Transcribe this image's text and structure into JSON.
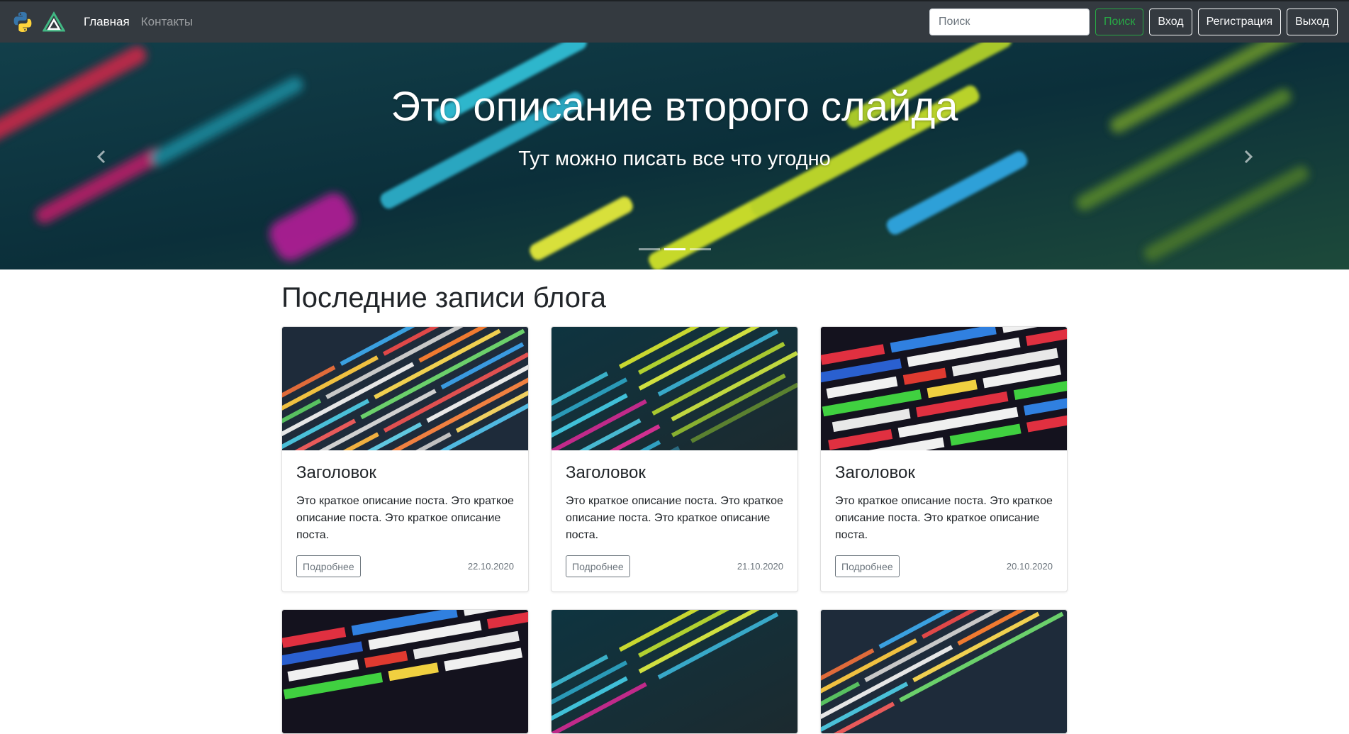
{
  "navbar": {
    "logos": [
      "python-logo",
      "vue-logo"
    ],
    "links": [
      {
        "label": "Главная",
        "active": true
      },
      {
        "label": "Контакты",
        "active": false
      }
    ],
    "search": {
      "placeholder": "Поиск",
      "value": ""
    },
    "buttons": {
      "search": "Поиск",
      "login": "Вход",
      "register": "Регистрация",
      "logout": "Выход"
    }
  },
  "carousel": {
    "title": "Это описание второго слайда",
    "subtitle": "Тут можно писать все что угодно",
    "prev_icon": "chevron-left-icon",
    "next_icon": "chevron-right-icon",
    "slide_count": 3,
    "active_slide": 2
  },
  "blog": {
    "heading": "Последние записи блога",
    "posts": [
      {
        "title": "Заголовок",
        "text": "Это краткое описание поста. Это краткое описание поста. Это краткое описание поста.",
        "button": "Подробнее",
        "date": "22.10.2020"
      },
      {
        "title": "Заголовок",
        "text": "Это краткое описание поста. Это краткое описание поста. Это краткое описание поста.",
        "button": "Подробнее",
        "date": "21.10.2020"
      },
      {
        "title": "Заголовок",
        "text": "Это краткое описание поста. Это краткое описание поста. Это краткое описание поста.",
        "button": "Подробнее",
        "date": "20.10.2020"
      }
    ]
  },
  "colors": {
    "navbar_bg": "#343a40",
    "success": "#28a745",
    "muted": "#6c757d"
  }
}
